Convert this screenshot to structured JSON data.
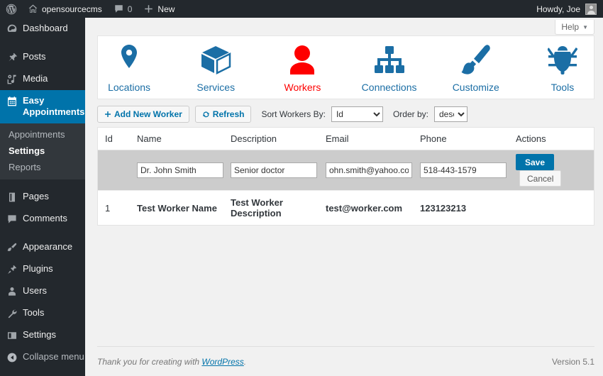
{
  "adminbar": {
    "wp_logo": "wordpress-logo-icon",
    "site_name": "opensourcecms",
    "comments_icon": "comment-icon",
    "comments_count": "0",
    "new_label": "New",
    "greeting": "Howdy, Joe",
    "avatar": "user-avatar"
  },
  "sidebar": {
    "items": [
      {
        "label": "Dashboard",
        "icon": "dashboard-icon",
        "current": false
      },
      {
        "label": "Posts",
        "icon": "pin-icon",
        "current": false
      },
      {
        "label": "Media",
        "icon": "media-icon",
        "current": false
      },
      {
        "label": "Easy Appointments",
        "icon": "calendar-icon",
        "current": true
      },
      {
        "label": "Pages",
        "icon": "pages-icon",
        "current": false
      },
      {
        "label": "Comments",
        "icon": "comment-icon",
        "current": false
      },
      {
        "label": "Appearance",
        "icon": "paintbrush-icon",
        "current": false
      },
      {
        "label": "Plugins",
        "icon": "plugin-icon",
        "current": false
      },
      {
        "label": "Users",
        "icon": "users-icon",
        "current": false
      },
      {
        "label": "Tools",
        "icon": "wrench-icon",
        "current": false
      },
      {
        "label": "Settings",
        "icon": "settings-icon",
        "current": false
      }
    ],
    "submenu": [
      {
        "label": "Appointments",
        "current": false
      },
      {
        "label": "Settings",
        "current": true
      },
      {
        "label": "Reports",
        "current": false
      }
    ],
    "collapse_label": "Collapse menu",
    "collapse_icon": "collapse-arrow-icon",
    "active_color": "#0073aa"
  },
  "help": {
    "label": "Help",
    "caret": "chevron-down-icon"
  },
  "iconnav": {
    "active_color": "#fe0000",
    "link_color": "#1b6ea5",
    "items": [
      {
        "label": "Locations",
        "icon": "map-pin-icon",
        "active": false
      },
      {
        "label": "Services",
        "icon": "box-icon",
        "active": false
      },
      {
        "label": "Workers",
        "icon": "person-icon",
        "active": true
      },
      {
        "label": "Connections",
        "icon": "sitemap-icon",
        "active": false
      },
      {
        "label": "Customize",
        "icon": "paintbrush-icon",
        "active": false
      },
      {
        "label": "Tools",
        "icon": "bug-icon",
        "active": false
      }
    ]
  },
  "toolbar": {
    "add_label": "Add New Worker",
    "add_icon": "plus-icon",
    "refresh_label": "Refresh",
    "refresh_icon": "refresh-icon",
    "sort_label": "Sort Workers By:",
    "sort_value": "Id",
    "sort_options": [
      "Id"
    ],
    "order_label": "Order by:",
    "order_value": "desc",
    "order_options": [
      "desc"
    ]
  },
  "table": {
    "headers": [
      "Id",
      "Name",
      "Description",
      "Email",
      "Phone",
      "Actions"
    ],
    "edit_row": {
      "name": "Dr. John Smith",
      "description": "Senior doctor",
      "email": "ohn.smith@yahoo.com",
      "phone": "518-443-1579",
      "save_label": "Save",
      "cancel_label": "Cancel"
    },
    "rows": [
      {
        "id": "1",
        "name": "Test Worker Name",
        "description": "Test Worker Description",
        "email": "test@worker.com",
        "phone": "123123213",
        "actions": ""
      }
    ]
  },
  "footer": {
    "thanks_prefix": "Thank you for creating with ",
    "wordpress_link": "WordPress",
    "thanks_suffix": ".",
    "version": "Version 5.1"
  }
}
